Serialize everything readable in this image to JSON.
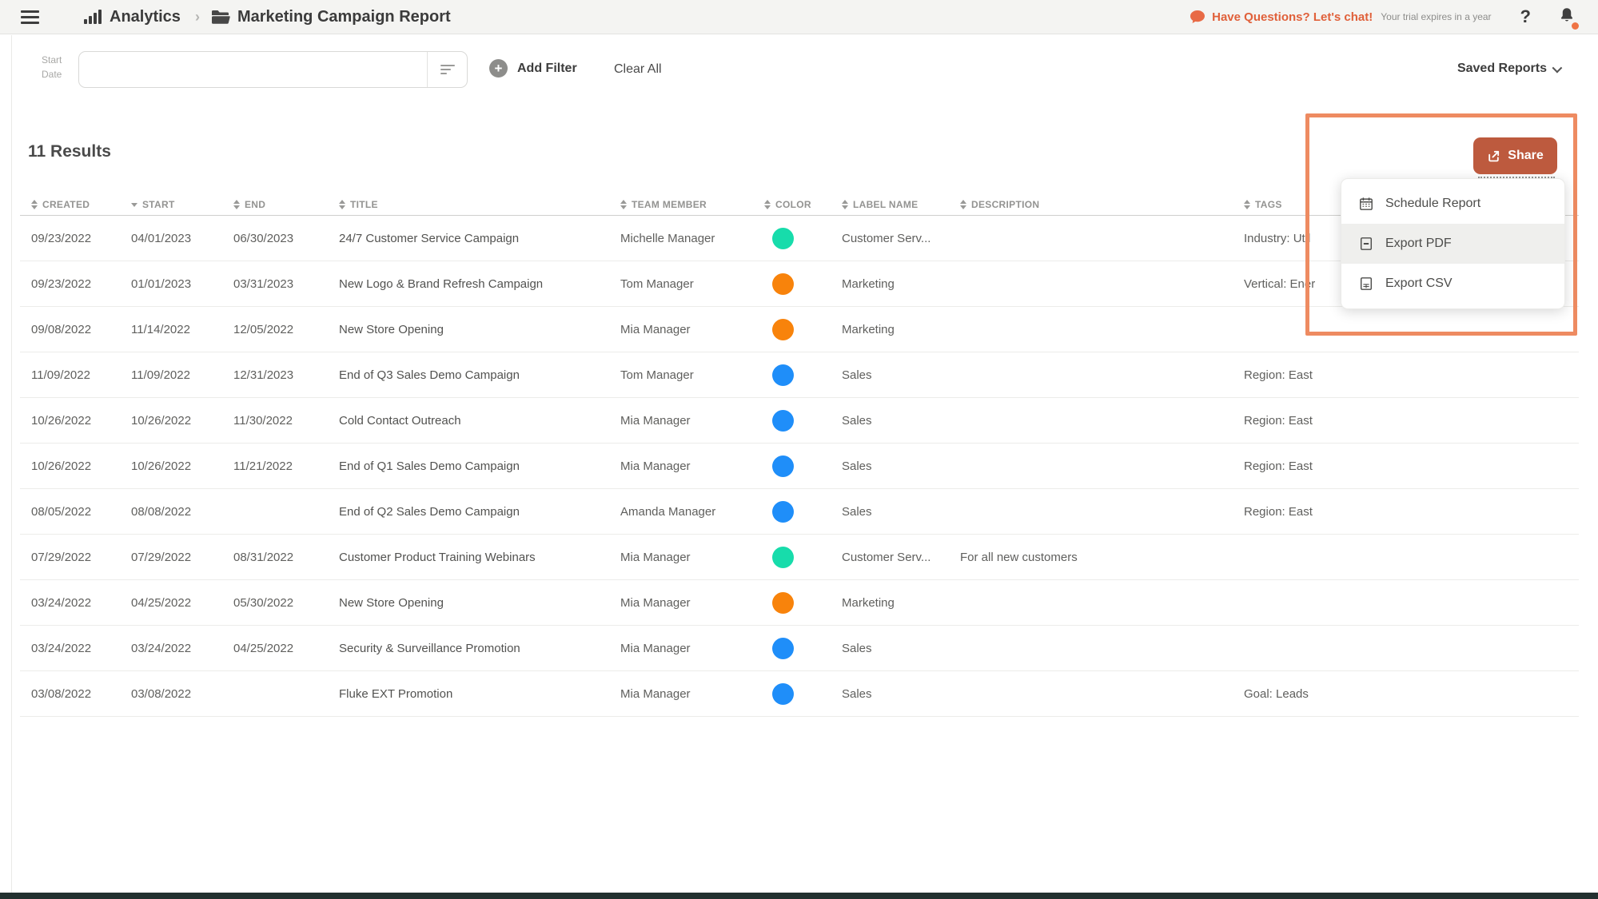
{
  "topbar": {
    "app": "Analytics",
    "separator": "›",
    "page": "Marketing Campaign Report",
    "chat": "Have Questions? Let's chat!",
    "trial": "Your trial expires in a year",
    "help": "?"
  },
  "filterbar": {
    "start_date_label": "Start Date",
    "start_date_value": "",
    "add_filter": "Add Filter",
    "clear_all": "Clear All",
    "saved_reports": "Saved Reports"
  },
  "results_count": "11 Results",
  "table": {
    "columns": [
      {
        "label": "CREATED",
        "sort": "both"
      },
      {
        "label": "START",
        "sort": "desc"
      },
      {
        "label": "END",
        "sort": "both"
      },
      {
        "label": "TITLE",
        "sort": "both"
      },
      {
        "label": "TEAM MEMBER",
        "sort": "both"
      },
      {
        "label": "COLOR",
        "sort": "both"
      },
      {
        "label": "LABEL NAME",
        "sort": "both"
      },
      {
        "label": "DESCRIPTION",
        "sort": "both"
      },
      {
        "label": "TAGS",
        "sort": "both"
      }
    ],
    "rows": [
      {
        "created": "09/23/2022",
        "start": "04/01/2023",
        "end": "06/30/2023",
        "title": "24/7 Customer Service Campaign",
        "team_member": "Michelle Manager",
        "color": "teal",
        "label_name": "Customer Serv...",
        "description": "",
        "tags": "Industry: Util"
      },
      {
        "created": "09/23/2022",
        "start": "01/01/2023",
        "end": "03/31/2023",
        "title": "New Logo & Brand Refresh Campaign",
        "team_member": "Tom Manager",
        "color": "orange",
        "label_name": "Marketing",
        "description": "",
        "tags": "Vertical: Ener"
      },
      {
        "created": "09/08/2022",
        "start": "11/14/2022",
        "end": "12/05/2022",
        "title": "New Store Opening",
        "team_member": "Mia Manager",
        "color": "orange",
        "label_name": "Marketing",
        "description": "",
        "tags": ""
      },
      {
        "created": "11/09/2022",
        "start": "11/09/2022",
        "end": "12/31/2023",
        "title": "End of Q3 Sales Demo Campaign",
        "team_member": "Tom Manager",
        "color": "blue",
        "label_name": "Sales",
        "description": "",
        "tags": "Region: East"
      },
      {
        "created": "10/26/2022",
        "start": "10/26/2022",
        "end": "11/30/2022",
        "title": "Cold Contact Outreach",
        "team_member": "Mia Manager",
        "color": "blue",
        "label_name": "Sales",
        "description": "",
        "tags": "Region: East"
      },
      {
        "created": "10/26/2022",
        "start": "10/26/2022",
        "end": "11/21/2022",
        "title": "End of Q1 Sales Demo Campaign",
        "team_member": "Mia Manager",
        "color": "blue",
        "label_name": "Sales",
        "description": "",
        "tags": "Region: East"
      },
      {
        "created": "08/05/2022",
        "start": "08/08/2022",
        "end": "",
        "title": "End of Q2 Sales Demo Campaign",
        "team_member": "Amanda Manager",
        "color": "blue",
        "label_name": "Sales",
        "description": "",
        "tags": "Region: East"
      },
      {
        "created": "07/29/2022",
        "start": "07/29/2022",
        "end": "08/31/2022",
        "title": "Customer Product Training Webinars",
        "team_member": "Mia Manager",
        "color": "teal",
        "label_name": "Customer Serv...",
        "description": "For all new customers",
        "tags": ""
      },
      {
        "created": "03/24/2022",
        "start": "04/25/2022",
        "end": "05/30/2022",
        "title": "New Store Opening",
        "team_member": "Mia Manager",
        "color": "orange",
        "label_name": "Marketing",
        "description": "",
        "tags": ""
      },
      {
        "created": "03/24/2022",
        "start": "03/24/2022",
        "end": "04/25/2022",
        "title": "Security & Surveillance Promotion",
        "team_member": "Mia Manager",
        "color": "blue",
        "label_name": "Sales",
        "description": "",
        "tags": ""
      },
      {
        "created": "03/08/2022",
        "start": "03/08/2022",
        "end": "",
        "title": "Fluke EXT Promotion",
        "team_member": "Mia Manager",
        "color": "blue",
        "label_name": "Sales",
        "description": "",
        "tags": "Goal: Leads"
      }
    ]
  },
  "share": {
    "button_label": "Share",
    "menu": [
      {
        "label": "Schedule Report",
        "icon": "calendar-icon",
        "highlighted": false
      },
      {
        "label": "Export PDF",
        "icon": "export-pdf-icon",
        "highlighted": true
      },
      {
        "label": "Export CSV",
        "icon": "export-csv-icon",
        "highlighted": false
      }
    ]
  },
  "colors": {
    "teal": "#17dcab",
    "orange": "#f8830b",
    "blue": "#1f8ef9",
    "accent_orange": "#e0603a",
    "share_button": "#bd5a3e",
    "highlight_border": "#ee8b61"
  }
}
